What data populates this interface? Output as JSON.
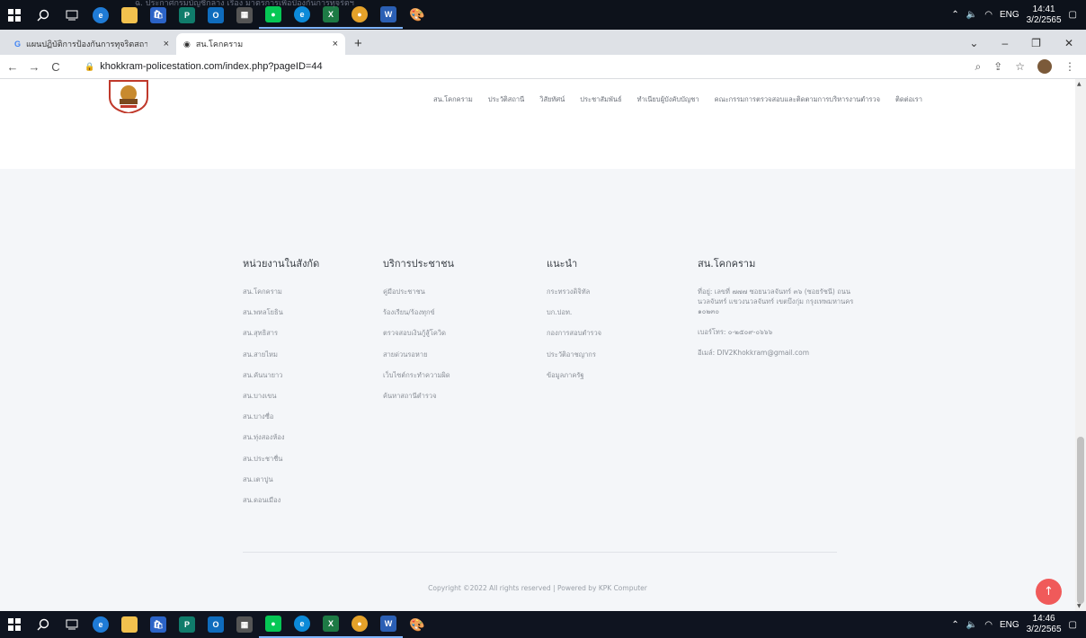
{
  "taskbar_top": {
    "tray_lang": "ENG",
    "time": "14:41",
    "date": "3/2/2565",
    "faint_text": "ฉ. ประกาศกรมบัญชีกลาง เรื่อง มาตรการเพื่อป้องกันการทุจริตฯ"
  },
  "taskbar_bottom": {
    "tray_lang": "ENG",
    "time": "14:46",
    "date": "3/2/2565"
  },
  "browser": {
    "tabs": [
      {
        "label": "แผนปฏิบัติการป้องกันการทุจริตสถานีตำรวจ",
        "active": false
      },
      {
        "label": "สน.โคกคราม",
        "active": true
      }
    ],
    "url": "khokkram-policestation.com/index.php?pageID=44"
  },
  "nav": {
    "items": [
      "สน.โคกคราม",
      "ประวัติสถานี",
      "วิสัยทัศน์",
      "ประชาสัมพันธ์",
      "ทำเนียบผู้บังคับบัญชา",
      "คณะกรรมการตรวจสอบและติดตามการบริหารงานตำรวจ",
      "ติดต่อเรา"
    ]
  },
  "footer": {
    "col1": {
      "title": "หน่วยงานในสังกัด",
      "links": [
        "สน.โคกคราม",
        "สน.พหลโยธิน",
        "สน.สุทธิสาร",
        "สน.สายไหม",
        "สน.คันนายาว",
        "สน.บางเขน",
        "สน.บางซื่อ",
        "สน.ทุ่งสองห้อง",
        "สน.ประชาชื่น",
        "สน.เตาปูน",
        "สน.ดอนเมือง"
      ]
    },
    "col2": {
      "title": "บริการประชาชน",
      "links": [
        "คู่มือประชาชน",
        "ร้องเรียน/ร้องทุกข์",
        "ตรวจสอบเงินกู้สู้โควิด",
        "สายด่วนรอหาย",
        "เว็บไซต์กระทำความผิด",
        "ค้นหาสถานีตำรวจ"
      ]
    },
    "col3": {
      "title": "แนะนำ",
      "links": [
        "กระทรวงดิจิทัล",
        "บก.ปอท.",
        "กองการสอบตำรวจ",
        "ประวัติอาชญากร",
        "ข้อมูลภาครัฐ"
      ]
    },
    "col4": {
      "title": "สน.โคกคราม",
      "address": "ที่อยู่: เลขที่ ๗๗๗ ซอยนวลจันทร์ ๓๖ (ซอยรัชนี) ถนนนวลจันทร์ แขวงนวลจันทร์ เขตบึงกุ่ม กรุงเทพมหานคร ๑๐๒๓๐",
      "phone": "เบอร์โทร: ๐-๒๕๐๙-๐๖๖๖",
      "email": "อีเมล์: DIV2Khokkram@gmail.com"
    },
    "copyright": "Copyright ©2022 All rights reserved | Powered by KPK Computer"
  },
  "colors": {
    "accent_button": "#f05a5a",
    "taskbar": "#0f1420"
  }
}
